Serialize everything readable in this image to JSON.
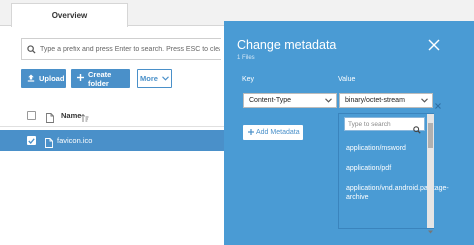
{
  "tabs": [
    {
      "label": "Overview"
    }
  ],
  "search": {
    "placeholder": "Type a prefix and press Enter to search. Press ESC to clear"
  },
  "toolbar": {
    "upload_label": "Upload",
    "create_folder_label": "Create folder",
    "more_label": "More"
  },
  "table": {
    "columns": [
      {
        "label": "Name"
      }
    ],
    "rows": [
      {
        "name": "favicon.ico",
        "selected": true
      }
    ]
  },
  "modal": {
    "title": "Change metadata",
    "subtitle": "1 Files",
    "key_label": "Key",
    "value_label": "Value",
    "rows": [
      {
        "key": "Content-Type",
        "value": "binary/octet-stream"
      }
    ],
    "add_label": "Add Metadata",
    "dropdown": {
      "search_placeholder": "Type to search",
      "options": [
        "application/msword",
        "application/pdf",
        "application/vnd.android.package-archive"
      ]
    }
  },
  "colors": {
    "accent": "#4a90c9",
    "panel": "#4a9bd4"
  },
  "icons": [
    "search-icon",
    "upload-icon",
    "plus-icon",
    "chevron-down-icon",
    "file-icon",
    "sort-icon",
    "close-icon",
    "remove-icon"
  ]
}
